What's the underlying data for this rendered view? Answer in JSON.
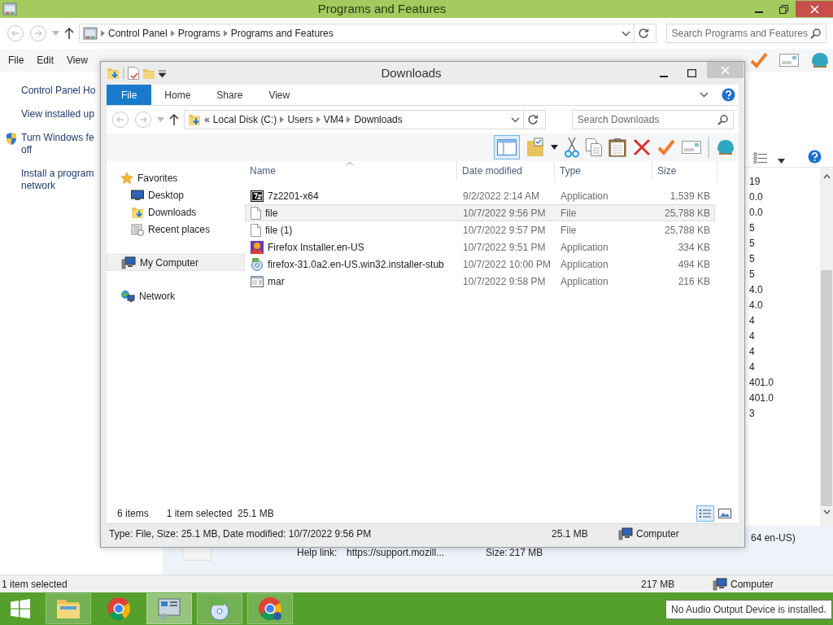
{
  "background_window": {
    "title": "Programs and Features",
    "breadcrumb": [
      "Control Panel",
      "Programs",
      "Programs and Features"
    ],
    "search": {
      "placeholder": "Search Programs and Features"
    },
    "menu": [
      "File",
      "Edit",
      "View"
    ],
    "tasks": [
      {
        "lines": [
          "Control Panel Ho"
        ],
        "kind": "link"
      },
      {
        "lines": [
          "View installed up"
        ],
        "kind": "link"
      },
      {
        "lines": [
          "Turn Windows fe",
          "off"
        ],
        "kind": "shield"
      },
      {
        "lines": [
          "Install a program",
          "network"
        ],
        "kind": "link"
      }
    ],
    "version_column": [
      "19",
      "0.0",
      "0.0",
      "5",
      "5",
      "5",
      "5",
      "4.0",
      "4.0",
      "4",
      "4",
      "4",
      "4",
      "401.0",
      "401.0",
      "3"
    ],
    "details": {
      "name": "64 en-US)",
      "help_link_label": "Help link:",
      "help_link": "https://support.mozill...",
      "size_label": "Size:",
      "size": "217 MB"
    },
    "status_bar": {
      "selection": "1 item selected",
      "size": "217 MB",
      "location": "Computer"
    }
  },
  "downloads_window": {
    "title": "Downloads",
    "ribbon_tabs": [
      {
        "label": "File",
        "selected": true
      },
      {
        "label": "Home",
        "selected": false
      },
      {
        "label": "Share",
        "selected": false
      },
      {
        "label": "View",
        "selected": false
      }
    ],
    "breadcrumb": [
      "Local Disk (C:)",
      "Users",
      "VM4",
      "Downloads"
    ],
    "overflow": "«",
    "search": {
      "placeholder": "Search Downloads"
    },
    "navigation": [
      {
        "label": "Favorites",
        "kind": "star",
        "selected": false,
        "children": [
          {
            "label": "Desktop",
            "kind": "desktop",
            "selected": false
          },
          {
            "label": "Downloads",
            "kind": "downloads",
            "selected": false
          },
          {
            "label": "Recent places",
            "kind": "recent",
            "selected": false
          }
        ]
      },
      {
        "label": "My Computer",
        "kind": "computer",
        "selected": true
      },
      {
        "label": "Network",
        "kind": "network",
        "selected": false
      }
    ],
    "columns": [
      "Name",
      "Date modified",
      "Type",
      "Size"
    ],
    "files": [
      {
        "name": "7z2201-x64",
        "date": "9/2/2022 2:14 AM",
        "type": "Application",
        "size": "1,539 KB",
        "kind": "archive",
        "selected": false
      },
      {
        "name": "file",
        "date": "10/7/2022 9:56 PM",
        "type": "File",
        "size": "25,788 KB",
        "kind": "blank",
        "selected": true
      },
      {
        "name": "file (1)",
        "date": "10/7/2022 9:57 PM",
        "type": "File",
        "size": "25,788 KB",
        "kind": "blank",
        "selected": false
      },
      {
        "name": "Firefox Installer.en-US",
        "date": "10/7/2022 9:51 PM",
        "type": "Application",
        "size": "334 KB",
        "kind": "firefox",
        "selected": false
      },
      {
        "name": "firefox-31.0a2.en-US.win32.installer-stub",
        "date": "10/7/2022 10:00 PM",
        "type": "Application",
        "size": "494 KB",
        "kind": "installer",
        "selected": false
      },
      {
        "name": "mar",
        "date": "10/7/2022 9:58 PM",
        "type": "Application",
        "size": "216 KB",
        "kind": "window",
        "selected": false
      }
    ],
    "status": {
      "count": "6 items",
      "selection": "1 item selected  25.1 MB"
    },
    "views": [
      {
        "kind": "details",
        "selected": true
      },
      {
        "kind": "tiles",
        "selected": false
      }
    ],
    "details_bar": {
      "summary": "Type: File, Size: 25.1 MB, Date modified: 10/7/2022 9:56 PM",
      "size": "25.1 MB",
      "location": "Computer"
    }
  },
  "taskbar": {
    "apps": [
      {
        "kind": "explorer",
        "running": true,
        "selected": false
      },
      {
        "kind": "chrome",
        "running": false,
        "selected": false
      },
      {
        "kind": "control-panel",
        "running": true,
        "selected": true
      },
      {
        "kind": "installer",
        "running": true,
        "selected": false
      },
      {
        "kind": "chrome-user",
        "running": true,
        "selected": false
      }
    ],
    "tooltip": "No Audio Output Device is installed."
  }
}
